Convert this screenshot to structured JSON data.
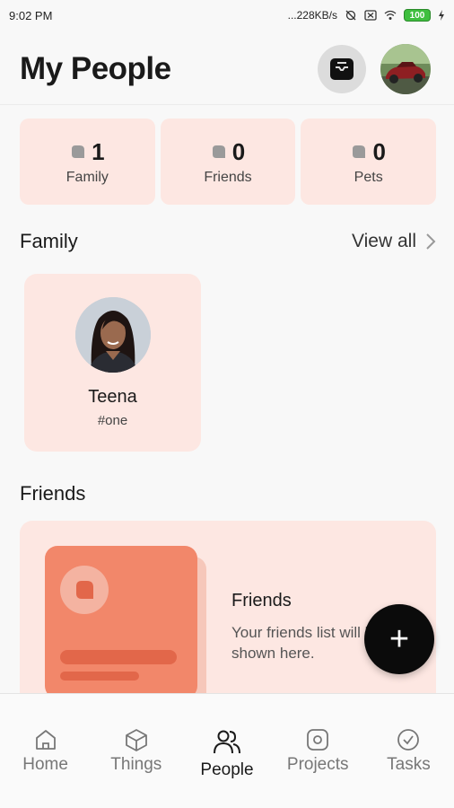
{
  "status_bar": {
    "time": "9:02 PM",
    "network_speed": "...228KB/s",
    "battery": "100"
  },
  "header": {
    "title": "My People"
  },
  "counts": [
    {
      "value": "1",
      "label": "Family"
    },
    {
      "value": "0",
      "label": "Friends"
    },
    {
      "value": "0",
      "label": "Pets"
    }
  ],
  "family_section": {
    "title": "Family",
    "view_all": "View all"
  },
  "family_members": [
    {
      "name": "Teena",
      "tag": "#one"
    }
  ],
  "friends_section": {
    "title": "Friends",
    "empty_title": "Friends",
    "empty_text": "Your friends list will be shown here."
  },
  "fab": {
    "label": "+"
  },
  "bottom_nav": [
    {
      "label": "Home",
      "icon": "home-icon"
    },
    {
      "label": "Things",
      "icon": "cube-icon"
    },
    {
      "label": "People",
      "icon": "people-icon"
    },
    {
      "label": "Projects",
      "icon": "projects-icon"
    },
    {
      "label": "Tasks",
      "icon": "check-circle-icon"
    }
  ],
  "colors": {
    "card_bg": "#fde7e2",
    "accent": "#f2876a",
    "fab": "#0b0b0b"
  }
}
